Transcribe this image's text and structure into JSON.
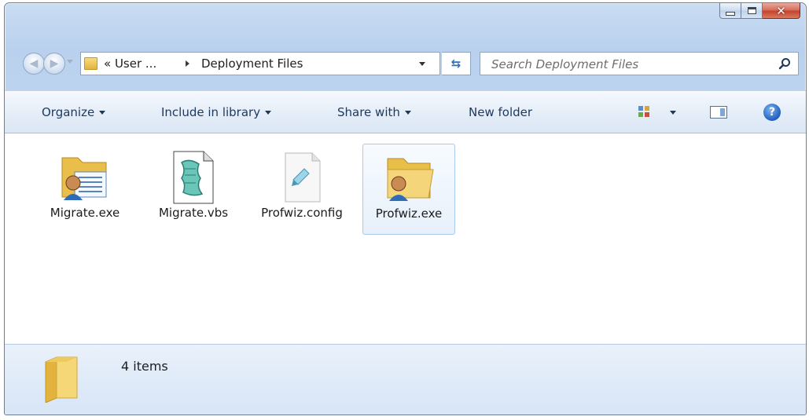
{
  "window": {
    "caption_buttons": [
      "minimize",
      "maximize",
      "close"
    ]
  },
  "nav": {
    "address_prefix": "« User ...",
    "address_current": "Deployment Files",
    "search_placeholder": "Search Deployment Files"
  },
  "toolbar": {
    "organize": "Organize",
    "include_in_library": "Include in library",
    "share_with": "Share with",
    "new_folder": "New folder"
  },
  "files": [
    {
      "name": "Migrate.exe",
      "icon": "user-folder-doc-icon"
    },
    {
      "name": "Migrate.vbs",
      "icon": "script-file-icon"
    },
    {
      "name": "Profwiz.config",
      "icon": "config-file-icon"
    },
    {
      "name": "Profwiz.exe",
      "icon": "user-folder-icon",
      "selected": true
    }
  ],
  "status": {
    "item_count": "4 items"
  },
  "colors": {
    "accent": "#1e395b",
    "selection": "#a9c9ea"
  }
}
